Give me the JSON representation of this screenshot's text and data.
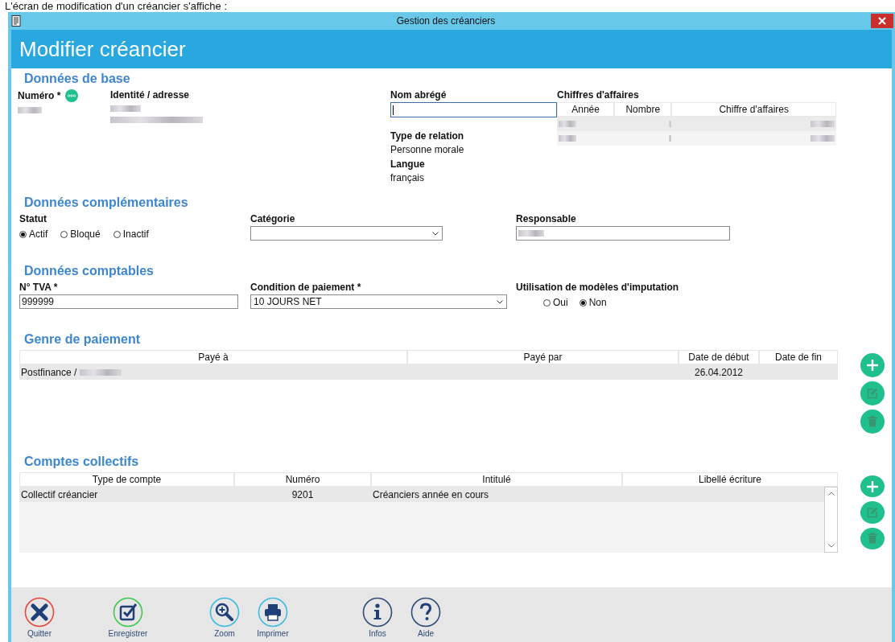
{
  "caption": "L'écran de modification d'un créancier s'affiche :",
  "window": {
    "title": "Gestion des créanciers"
  },
  "header": "Modifier créancier",
  "base": {
    "title": "Données de base",
    "numero_label": "Numéro *",
    "numero_redacted": true,
    "identite_label": "Identité / adresse",
    "identite_redacted": true,
    "nom_abrege_label": "Nom abrégé",
    "relation_label": "Type de relation",
    "relation_value": "Personne morale",
    "langue_label": "Langue",
    "langue_value": "français",
    "turnover": {
      "title": "Chiffres d'affaires",
      "columns": [
        "Année",
        "Nombre",
        "Chiffre d'affaires"
      ],
      "rows": [
        {
          "redacted": true
        },
        {
          "redacted": true
        }
      ]
    }
  },
  "complementary": {
    "title": "Données complémentaires",
    "statut_label": "Statut",
    "statut_options": [
      {
        "label": "Actif",
        "selected": true
      },
      {
        "label": "Bloqué",
        "selected": false
      },
      {
        "label": "Inactif",
        "selected": false
      }
    ],
    "categorie_label": "Catégorie",
    "responsable_label": "Responsable",
    "responsable_redacted": true
  },
  "accounting": {
    "title": "Données comptables",
    "tva_label": "N° TVA *",
    "tva_value": "999999",
    "condition_label": "Condition de paiement *",
    "condition_value": "10 JOURS NET",
    "modeles_label": "Utilisation de modèles d'imputation",
    "modeles_options": [
      {
        "label": "Oui",
        "selected": false
      },
      {
        "label": "Non",
        "selected": true
      }
    ]
  },
  "payment": {
    "title": "Genre de paiement",
    "columns": [
      "Payé à",
      "Payé par",
      "Date de début",
      "Date de fin"
    ],
    "rows": [
      {
        "paye_a": "Postfinance /",
        "redacted": true,
        "date_debut": "26.04.2012"
      }
    ]
  },
  "collective": {
    "title": "Comptes collectifs",
    "columns": [
      "Type de compte",
      "Numéro",
      "Intitulé",
      "Libellé écriture"
    ],
    "rows": [
      {
        "type": "Collectif créancier",
        "numero": "9201",
        "intitule": "Créanciers année en cours"
      }
    ]
  },
  "toolbar": [
    {
      "kind": "quit",
      "label": "Quitter"
    },
    {
      "kind": "save",
      "label": "Enregistrer"
    },
    {
      "kind": "zoom",
      "label": "Zoom"
    },
    {
      "kind": "print",
      "label": "Imprimer"
    },
    {
      "kind": "info",
      "label": "Infos"
    },
    {
      "kind": "help",
      "label": "Aide"
    }
  ]
}
